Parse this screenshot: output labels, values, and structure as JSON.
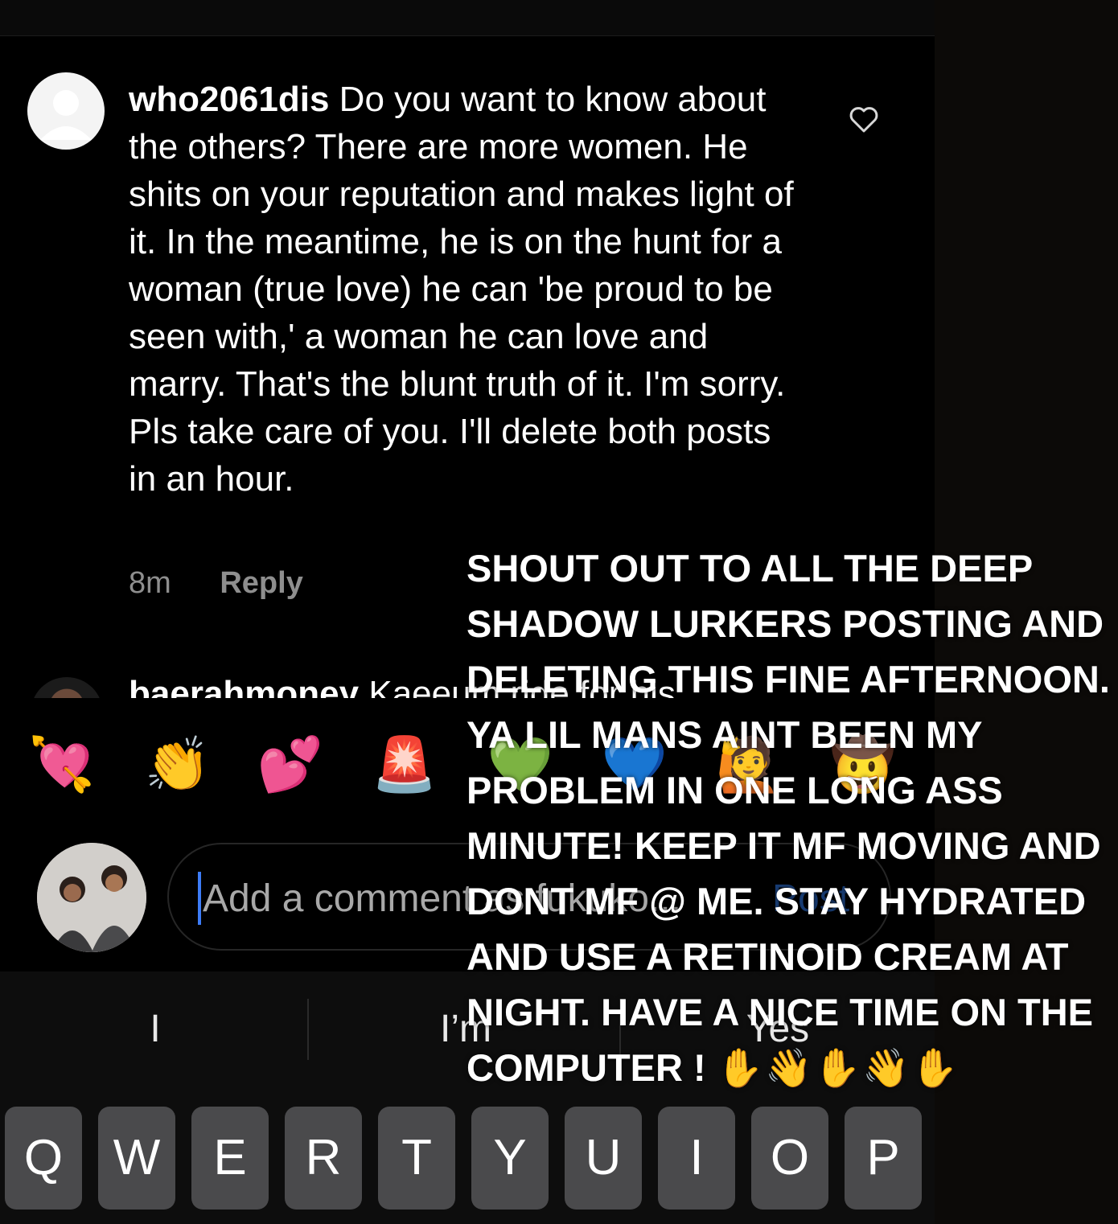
{
  "comment": {
    "username": "who2061dis",
    "text": "Do you want to know about the others? There are more women. He shits on your reputation and makes light of it. In the meantime, he is on the hunt for a woman (true love) he can 'be proud to be seen with,' a woman he can love and marry. That's the blunt truth of it. I'm sorry. Pls take care of you. I'll delete both posts in an hour.",
    "time": "8m",
    "reply_label": "Reply"
  },
  "next_comment": {
    "username": "baerahmoney",
    "text": "Kaeeum ride for his"
  },
  "emoji_bar": [
    "💘",
    "👏",
    "💕",
    "🚨",
    "💚",
    "💙",
    "🙋",
    "🤠"
  ],
  "composer": {
    "placeholder": "Add a comment as fukuko...",
    "post_label": "Post"
  },
  "suggestions": [
    "I",
    "I’m",
    "Yes"
  ],
  "keyboard_row": [
    "Q",
    "W",
    "E",
    "R",
    "T",
    "Y",
    "U",
    "I",
    "O",
    "P"
  ],
  "overlay": {
    "text": "SHOUT OUT TO ALL THE DEEP SHADOW LURKERS POSTING AND DELETING THIS FINE AFTERNOON. YA LIL MANS AINT BEEN MY PROBLEM IN ONE LONG ASS MINUTE! KEEP IT MF MOVING AND DONT MF @ ME. STAY HYDRATED AND USE A RETINOID CREAM AT NIGHT. HAVE A NICE TIME ON THE COMPUTER !",
    "hands": "✋👋✋👋✋"
  }
}
